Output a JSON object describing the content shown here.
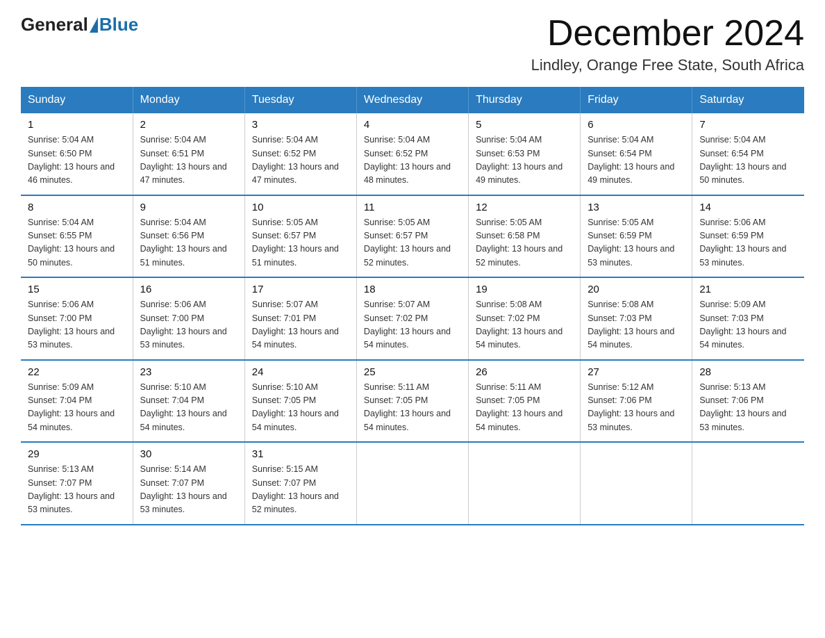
{
  "header": {
    "logo": {
      "general": "General",
      "blue": "Blue"
    },
    "title": "December 2024",
    "subtitle": "Lindley, Orange Free State, South Africa"
  },
  "calendar": {
    "weekdays": [
      "Sunday",
      "Monday",
      "Tuesday",
      "Wednesday",
      "Thursday",
      "Friday",
      "Saturday"
    ],
    "weeks": [
      [
        {
          "day": "1",
          "sunrise": "5:04 AM",
          "sunset": "6:50 PM",
          "daylight": "13 hours and 46 minutes."
        },
        {
          "day": "2",
          "sunrise": "5:04 AM",
          "sunset": "6:51 PM",
          "daylight": "13 hours and 47 minutes."
        },
        {
          "day": "3",
          "sunrise": "5:04 AM",
          "sunset": "6:52 PM",
          "daylight": "13 hours and 47 minutes."
        },
        {
          "day": "4",
          "sunrise": "5:04 AM",
          "sunset": "6:52 PM",
          "daylight": "13 hours and 48 minutes."
        },
        {
          "day": "5",
          "sunrise": "5:04 AM",
          "sunset": "6:53 PM",
          "daylight": "13 hours and 49 minutes."
        },
        {
          "day": "6",
          "sunrise": "5:04 AM",
          "sunset": "6:54 PM",
          "daylight": "13 hours and 49 minutes."
        },
        {
          "day": "7",
          "sunrise": "5:04 AM",
          "sunset": "6:54 PM",
          "daylight": "13 hours and 50 minutes."
        }
      ],
      [
        {
          "day": "8",
          "sunrise": "5:04 AM",
          "sunset": "6:55 PM",
          "daylight": "13 hours and 50 minutes."
        },
        {
          "day": "9",
          "sunrise": "5:04 AM",
          "sunset": "6:56 PM",
          "daylight": "13 hours and 51 minutes."
        },
        {
          "day": "10",
          "sunrise": "5:05 AM",
          "sunset": "6:57 PM",
          "daylight": "13 hours and 51 minutes."
        },
        {
          "day": "11",
          "sunrise": "5:05 AM",
          "sunset": "6:57 PM",
          "daylight": "13 hours and 52 minutes."
        },
        {
          "day": "12",
          "sunrise": "5:05 AM",
          "sunset": "6:58 PM",
          "daylight": "13 hours and 52 minutes."
        },
        {
          "day": "13",
          "sunrise": "5:05 AM",
          "sunset": "6:59 PM",
          "daylight": "13 hours and 53 minutes."
        },
        {
          "day": "14",
          "sunrise": "5:06 AM",
          "sunset": "6:59 PM",
          "daylight": "13 hours and 53 minutes."
        }
      ],
      [
        {
          "day": "15",
          "sunrise": "5:06 AM",
          "sunset": "7:00 PM",
          "daylight": "13 hours and 53 minutes."
        },
        {
          "day": "16",
          "sunrise": "5:06 AM",
          "sunset": "7:00 PM",
          "daylight": "13 hours and 53 minutes."
        },
        {
          "day": "17",
          "sunrise": "5:07 AM",
          "sunset": "7:01 PM",
          "daylight": "13 hours and 54 minutes."
        },
        {
          "day": "18",
          "sunrise": "5:07 AM",
          "sunset": "7:02 PM",
          "daylight": "13 hours and 54 minutes."
        },
        {
          "day": "19",
          "sunrise": "5:08 AM",
          "sunset": "7:02 PM",
          "daylight": "13 hours and 54 minutes."
        },
        {
          "day": "20",
          "sunrise": "5:08 AM",
          "sunset": "7:03 PM",
          "daylight": "13 hours and 54 minutes."
        },
        {
          "day": "21",
          "sunrise": "5:09 AM",
          "sunset": "7:03 PM",
          "daylight": "13 hours and 54 minutes."
        }
      ],
      [
        {
          "day": "22",
          "sunrise": "5:09 AM",
          "sunset": "7:04 PM",
          "daylight": "13 hours and 54 minutes."
        },
        {
          "day": "23",
          "sunrise": "5:10 AM",
          "sunset": "7:04 PM",
          "daylight": "13 hours and 54 minutes."
        },
        {
          "day": "24",
          "sunrise": "5:10 AM",
          "sunset": "7:05 PM",
          "daylight": "13 hours and 54 minutes."
        },
        {
          "day": "25",
          "sunrise": "5:11 AM",
          "sunset": "7:05 PM",
          "daylight": "13 hours and 54 minutes."
        },
        {
          "day": "26",
          "sunrise": "5:11 AM",
          "sunset": "7:05 PM",
          "daylight": "13 hours and 54 minutes."
        },
        {
          "day": "27",
          "sunrise": "5:12 AM",
          "sunset": "7:06 PM",
          "daylight": "13 hours and 53 minutes."
        },
        {
          "day": "28",
          "sunrise": "5:13 AM",
          "sunset": "7:06 PM",
          "daylight": "13 hours and 53 minutes."
        }
      ],
      [
        {
          "day": "29",
          "sunrise": "5:13 AM",
          "sunset": "7:07 PM",
          "daylight": "13 hours and 53 minutes."
        },
        {
          "day": "30",
          "sunrise": "5:14 AM",
          "sunset": "7:07 PM",
          "daylight": "13 hours and 53 minutes."
        },
        {
          "day": "31",
          "sunrise": "5:15 AM",
          "sunset": "7:07 PM",
          "daylight": "13 hours and 52 minutes."
        },
        null,
        null,
        null,
        null
      ]
    ]
  }
}
